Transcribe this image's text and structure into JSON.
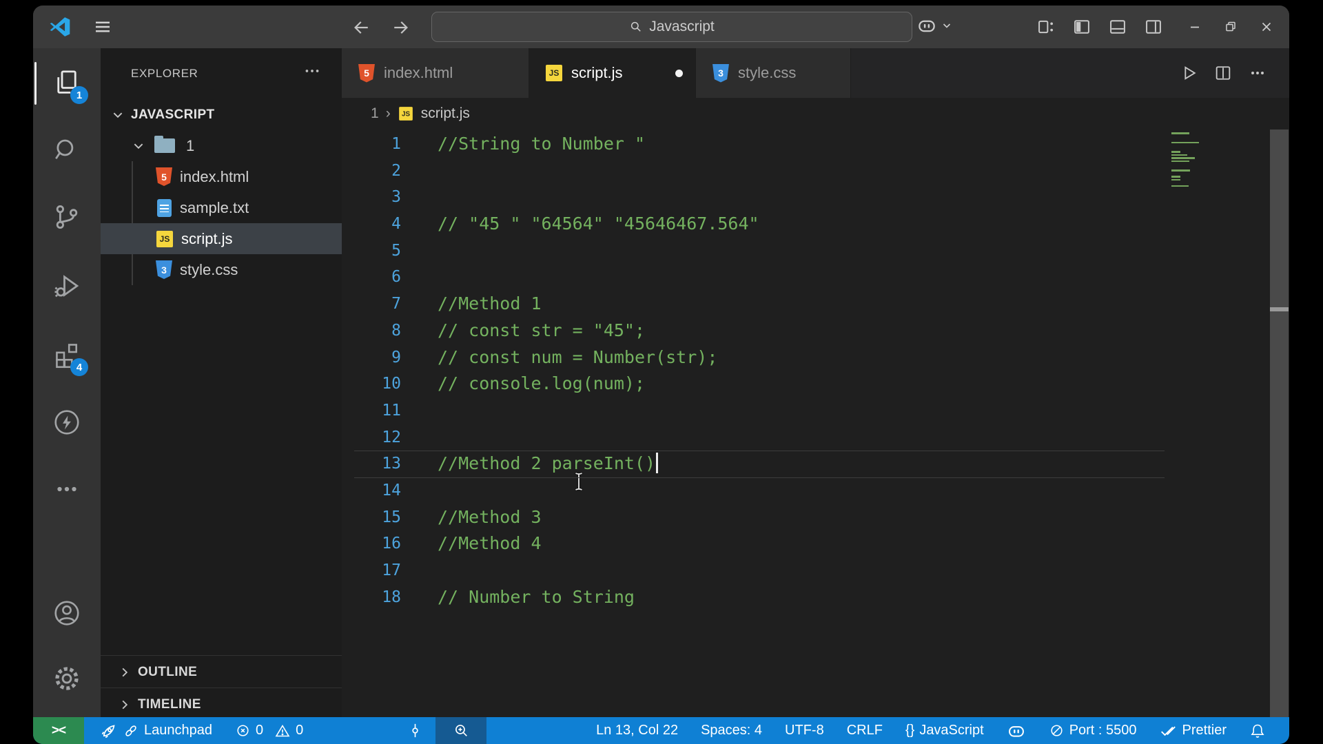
{
  "titlebar": {
    "search_label": "Javascript"
  },
  "activity_bar": {
    "explorer_badge": "1",
    "extensions_badge": "4"
  },
  "explorer": {
    "title": "EXPLORER",
    "workspace": "JAVASCRIPT",
    "folder": "1",
    "files": [
      {
        "name": "index.html"
      },
      {
        "name": "sample.txt"
      },
      {
        "name": "script.js"
      },
      {
        "name": "style.css"
      }
    ],
    "panels": {
      "outline": "OUTLINE",
      "timeline": "TIMELINE"
    }
  },
  "tabs": [
    {
      "label": "index.html"
    },
    {
      "label": "script.js"
    },
    {
      "label": "style.css"
    }
  ],
  "file_icon_glyphs": {
    "html": "5",
    "css": "3",
    "js": "JS"
  },
  "breadcrumb": {
    "root": "1",
    "separator": "›",
    "file": "script.js"
  },
  "editor": {
    "current_line": "13",
    "lines": [
      {
        "n": "1",
        "t": "//String to Number \""
      },
      {
        "n": "2",
        "t": ""
      },
      {
        "n": "3",
        "t": ""
      },
      {
        "n": "4",
        "t": "// \"45 \" \"64564\" \"45646467.564\""
      },
      {
        "n": "5",
        "t": ""
      },
      {
        "n": "6",
        "t": ""
      },
      {
        "n": "7",
        "t": "//Method 1"
      },
      {
        "n": "8",
        "t": "// const str = \"45\";"
      },
      {
        "n": "9",
        "t": "// const num = Number(str);"
      },
      {
        "n": "10",
        "t": "// console.log(num);"
      },
      {
        "n": "11",
        "t": ""
      },
      {
        "n": "12",
        "t": ""
      },
      {
        "n": "13",
        "t": "//Method 2 parseInt()"
      },
      {
        "n": "14",
        "t": ""
      },
      {
        "n": "15",
        "t": "//Method 3"
      },
      {
        "n": "16",
        "t": "//Method 4"
      },
      {
        "n": "17",
        "t": ""
      },
      {
        "n": "18",
        "t": "// Number to String"
      }
    ]
  },
  "minimap": {
    "bars": [
      [
        0,
        26
      ],
      [
        3,
        40
      ],
      [
        6,
        13
      ],
      [
        7,
        23
      ],
      [
        8,
        34
      ],
      [
        9,
        26
      ],
      [
        12,
        27
      ],
      [
        14,
        13
      ],
      [
        15,
        13
      ],
      [
        17,
        25
      ]
    ]
  },
  "status_bar": {
    "remote": "><",
    "launchpad": "Launchpad",
    "errors": "0",
    "warnings": "0",
    "cursor_position": "Ln 13, Col 22",
    "indentation": "Spaces: 4",
    "encoding": "UTF-8",
    "eol": "CRLF",
    "braces": "{}",
    "language": "JavaScript",
    "port": "Port : 5500",
    "formatter": "Prettier"
  }
}
